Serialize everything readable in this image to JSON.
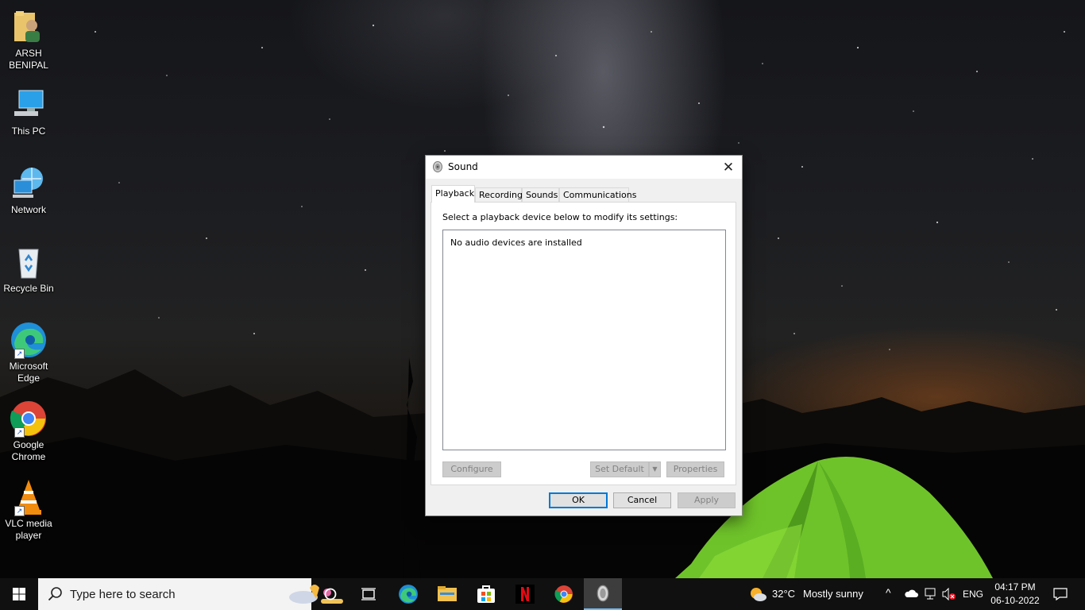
{
  "desktop": {
    "icons": [
      {
        "label_l1": "ARSH",
        "label_l2": "BENIPAL",
        "icon": "user-folder-icon"
      },
      {
        "label_l1": "This PC",
        "label_l2": "",
        "icon": "computer-icon"
      },
      {
        "label_l1": "Network",
        "label_l2": "",
        "icon": "network-icon"
      },
      {
        "label_l1": "Recycle Bin",
        "label_l2": "",
        "icon": "recycle-bin-icon"
      },
      {
        "label_l1": "Microsoft",
        "label_l2": "Edge",
        "icon": "edge-icon"
      },
      {
        "label_l1": "Google",
        "label_l2": "Chrome",
        "icon": "chrome-icon"
      },
      {
        "label_l1": "VLC media",
        "label_l2": "player",
        "icon": "vlc-icon"
      }
    ]
  },
  "dialog": {
    "title": "Sound",
    "tabs": [
      "Playback",
      "Recording",
      "Sounds",
      "Communications"
    ],
    "active_tab": "Playback",
    "instruction": "Select a playback device below to modify its settings:",
    "empty_message": "No audio devices are installed",
    "buttons": {
      "configure": "Configure",
      "set_default": "Set Default",
      "properties": "Properties",
      "ok": "OK",
      "cancel": "Cancel",
      "apply": "Apply"
    }
  },
  "taskbar": {
    "search_placeholder": "Type here to search",
    "pinned": [
      "task-view-icon",
      "edge-icon",
      "file-explorer-icon",
      "microsoft-store-icon",
      "netflix-icon",
      "chrome-icon",
      "sound-icon"
    ],
    "weather": {
      "temp": "32°C",
      "condition": "Mostly sunny"
    },
    "language": "ENG",
    "time": "04:17 PM",
    "date": "06-10-2022"
  }
}
